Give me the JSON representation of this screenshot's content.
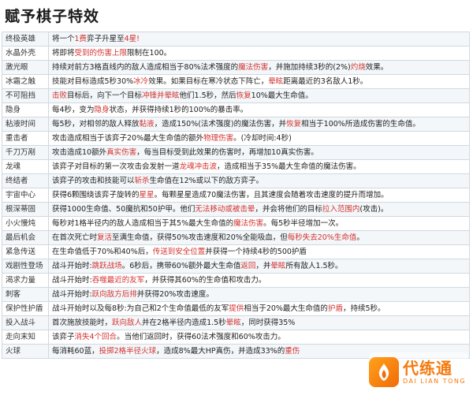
{
  "title": "赋予棋子特效",
  "colors": {
    "highlight": "#d2332f",
    "border": "#cfd8e0",
    "logo": "#f47a0e"
  },
  "rows": [
    {
      "name": "终极英雄",
      "segments": [
        {
          "t": "将一个"
        },
        {
          "t": "1费",
          "hl": true
        },
        {
          "t": "弈子升星至"
        },
        {
          "t": "4星!",
          "hl": true
        }
      ]
    },
    {
      "name": "水晶外壳",
      "segments": [
        {
          "t": "将即将"
        },
        {
          "t": "受到的伤害上限",
          "hl": true
        },
        {
          "t": "限制在100。"
        }
      ]
    },
    {
      "name": "激光眼",
      "segments": [
        {
          "t": "持续对前方3格直线内的敌人造成相当于80%法术强度的"
        },
        {
          "t": "魔法伤害",
          "hl": true
        },
        {
          "t": "，并施加持续3秒的(2%)"
        },
        {
          "t": "灼烧",
          "hl": true
        },
        {
          "t": "效果。"
        }
      ]
    },
    {
      "name": "冰霜之触",
      "segments": [
        {
          "t": "技能对目标造成5秒30%"
        },
        {
          "t": "冰冷",
          "hl": true
        },
        {
          "t": "效果。如果目标在寒冷状态下阵亡，"
        },
        {
          "t": "晕眩",
          "hl": true
        },
        {
          "t": "距离最近的3名敌人1秒。"
        }
      ]
    },
    {
      "name": "不可阻挡",
      "segments": [
        {
          "t": "击败",
          "hl": true
        },
        {
          "t": "目标后，向下一个目标"
        },
        {
          "t": "冲锋并晕眩",
          "hl": true
        },
        {
          "t": "他们1.5秒，然后"
        },
        {
          "t": "恢复",
          "hl": true
        },
        {
          "t": "10%最大生命值。"
        }
      ]
    },
    {
      "name": "隐身",
      "segments": [
        {
          "t": "每4秒，变为"
        },
        {
          "t": "隐身",
          "hl": true
        },
        {
          "t": "状态，并获得持续1秒的100%的暴击率。"
        }
      ]
    },
    {
      "name": "粘液时间",
      "segments": [
        {
          "t": "每5秒，对相邻的敌人释放"
        },
        {
          "t": "黏液",
          "hl": true
        },
        {
          "t": "，造成150%(法术强度)的魔法伤害，并"
        },
        {
          "t": "恢复",
          "hl": true
        },
        {
          "t": "相当于100%所造成伤害的生命值。"
        }
      ]
    },
    {
      "name": "重击者",
      "segments": [
        {
          "t": "攻击造成相当于该弈子20%最大生命值的额外"
        },
        {
          "t": "物理伤害",
          "hl": true
        },
        {
          "t": "。(冷却时间:4秒)"
        }
      ]
    },
    {
      "name": "千刀万剐",
      "segments": [
        {
          "t": "攻击造成10额外"
        },
        {
          "t": "真实伤害",
          "hl": true
        },
        {
          "t": "，每当目标受到此效果的伤害时，再增加10真实伤害。"
        }
      ]
    },
    {
      "name": "龙魂",
      "segments": [
        {
          "t": "该弈子对目标的第一次攻击会发射一道"
        },
        {
          "t": "龙魂冲击波",
          "hl": true
        },
        {
          "t": "，造成相当于35%最大生命值的魔法伤害。"
        }
      ]
    },
    {
      "name": "终结者",
      "segments": [
        {
          "t": "该弈子的攻击和技能可以"
        },
        {
          "t": "斩杀",
          "hl": true
        },
        {
          "t": "生命值在12%或以下的敌方弈子。"
        }
      ]
    },
    {
      "name": "宇宙中心",
      "segments": [
        {
          "t": "获得6颗围绕该弈子旋转的"
        },
        {
          "t": "星星",
          "hl": true
        },
        {
          "t": "。每颗星星造成70魔法伤害，且其速度会随着攻击速度的提升而增加。"
        }
      ]
    },
    {
      "name": "根深蒂固",
      "segments": [
        {
          "t": "获得1000生命值、50魔抗和50护甲。他们"
        },
        {
          "t": "无法移动或被击晕",
          "hl": true
        },
        {
          "t": "，并会将他们的目标"
        },
        {
          "t": "拉入范围内",
          "hl": true
        },
        {
          "t": "(攻击)。"
        }
      ]
    },
    {
      "name": "小火慢炖",
      "segments": [
        {
          "t": "每秒对1格半径内的敌人造成相当于其5%最大生命值的"
        },
        {
          "t": "魔法伤害",
          "hl": true
        },
        {
          "t": "。每5秒半径增加一次。"
        }
      ]
    },
    {
      "name": "最后机会",
      "segments": [
        {
          "t": "在首次死亡时"
        },
        {
          "t": "复活",
          "hl": true
        },
        {
          "t": "至满生命值，获得50%攻击速度和20%全能吸血，但"
        },
        {
          "t": "每秒失去20%生命值",
          "hl": true
        },
        {
          "t": "。"
        }
      ]
    },
    {
      "name": "紧急传送",
      "segments": [
        {
          "t": "在生命值低于70%和40%后，"
        },
        {
          "t": "传送到安全位置",
          "hl": true
        },
        {
          "t": "并获得一个持续4秒的500护盾"
        }
      ]
    },
    {
      "name": "戏剧性登场",
      "segments": [
        {
          "t": "战斗开始时:"
        },
        {
          "t": "跳跃战场",
          "hl": true
        },
        {
          "t": "。6秒后，携带60%额外最大生命值"
        },
        {
          "t": "返回",
          "hl": true
        },
        {
          "t": "，并"
        },
        {
          "t": "晕眩",
          "hl": true
        },
        {
          "t": "所有敌人1.5秒。"
        }
      ]
    },
    {
      "name": "渴求力量",
      "segments": [
        {
          "t": "战斗开始时:"
        },
        {
          "t": "吞噬最近的友军",
          "hl": true
        },
        {
          "t": "，并获得其60%的生命值和攻击力。"
        }
      ]
    },
    {
      "name": "刺客",
      "segments": [
        {
          "t": "战斗开始时:"
        },
        {
          "t": "跃向敌方后排",
          "hl": true
        },
        {
          "t": "并获得20%攻击速度。"
        }
      ]
    },
    {
      "name": "保护性护盾",
      "segments": [
        {
          "t": "战斗开始时以及每8秒:为自己和2个生命值最低的友军"
        },
        {
          "t": "提供",
          "hl": true
        },
        {
          "t": "相当于20%最大生命值的"
        },
        {
          "t": "护盾",
          "hl": true
        },
        {
          "t": "，持续5秒。"
        }
      ]
    },
    {
      "name": "投入战斗",
      "segments": [
        {
          "t": "首次施放技能时，"
        },
        {
          "t": "跃向敌人",
          "hl": true
        },
        {
          "t": "并在2格半径内造成1.5秒"
        },
        {
          "t": "晕眩",
          "hl": true
        },
        {
          "t": "，同时获得35%"
        }
      ]
    },
    {
      "name": "走向末知",
      "segments": [
        {
          "t": "该弈子"
        },
        {
          "t": "消失4个回合",
          "hl": true
        },
        {
          "t": "。当他们返回时，获得60法术强度和60%攻击力。"
        }
      ]
    },
    {
      "name": "火球",
      "segments": [
        {
          "t": "每消耗60蓝，"
        },
        {
          "t": "投掷2格半径火球",
          "hl": true
        },
        {
          "t": "，造成8%最大HP真伤，并造成33%的"
        },
        {
          "t": "重伤",
          "hl": true
        }
      ]
    }
  ],
  "logo": {
    "main": "代练通",
    "sub": "DAI LIAN TONG",
    "icon": "flame-logo-icon"
  }
}
